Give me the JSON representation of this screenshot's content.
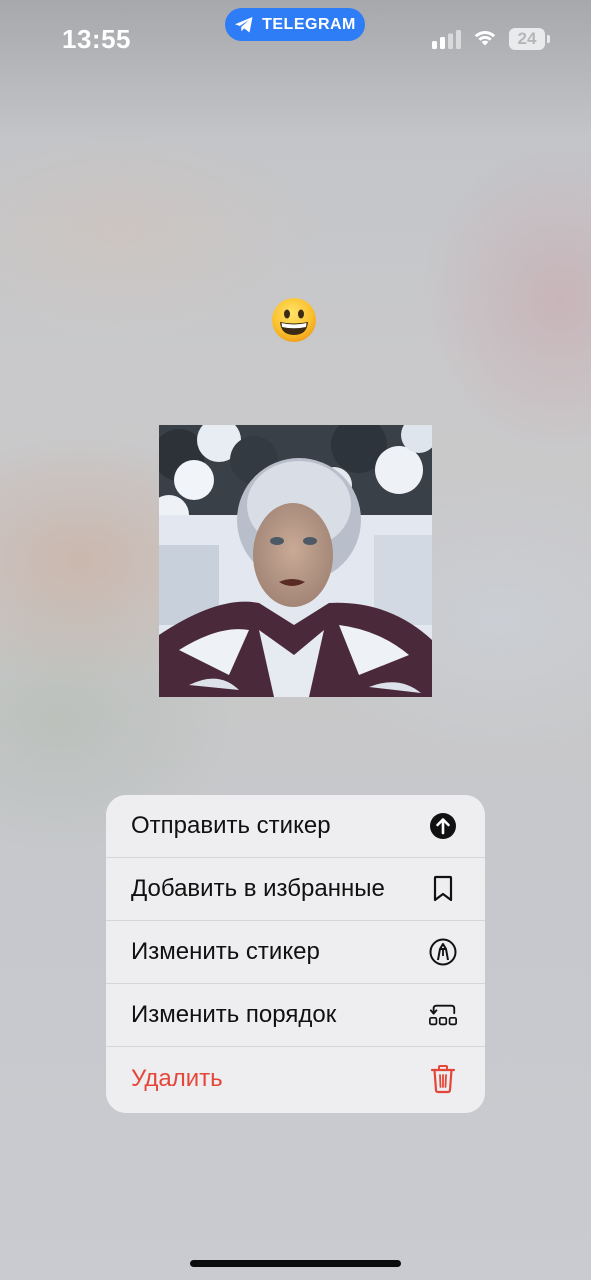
{
  "status_bar": {
    "time": "13:55",
    "app_pill_label": "TELEGRAM",
    "battery_level": "24"
  },
  "emoji": {
    "icon": "grinning-face-emoji"
  },
  "sticker": {
    "icon": "sticker-image-woman-in-snow"
  },
  "context_menu": {
    "items": [
      {
        "label": "Отправить стикер",
        "icon": "send-arrow-up-icon"
      },
      {
        "label": "Добавить в избранные",
        "icon": "bookmark-icon"
      },
      {
        "label": "Изменить стикер",
        "icon": "pen-circle-icon"
      },
      {
        "label": "Изменить порядок",
        "icon": "reorder-icon"
      },
      {
        "label": "Удалить",
        "icon": "trash-icon"
      }
    ]
  },
  "colors": {
    "accent": "#2f7df6",
    "danger": "#e5463a",
    "menu_background": "#eeeef0"
  }
}
